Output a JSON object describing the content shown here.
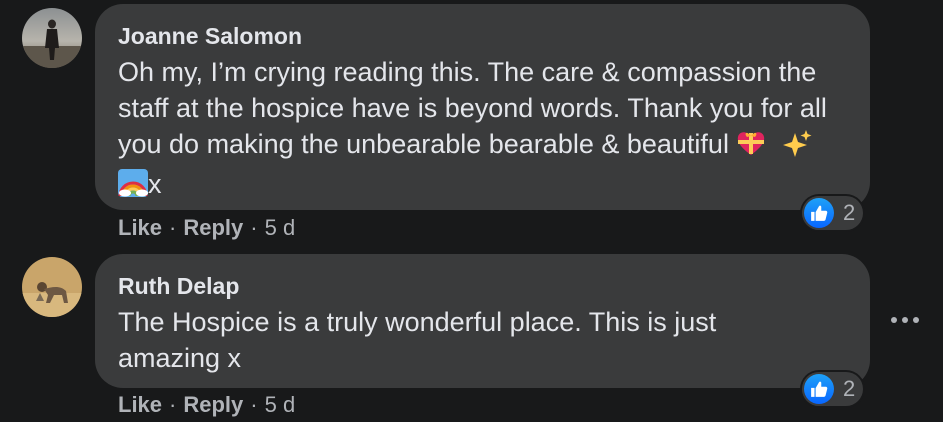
{
  "comments": [
    {
      "author": "Joanne Salomon",
      "text_main": "Oh my, I’m crying reading this. The care & compassion the staff at the hospice have is beyond words. Thank you for all you do making the unbearable bearable & beautiful",
      "text_suffix": "x",
      "emojis": [
        "heart-with-ribbon",
        "sparkles",
        "rainbow"
      ],
      "reaction_count": "2",
      "like_label": "Like",
      "reply_label": "Reply",
      "time": "5 d"
    },
    {
      "author": "Ruth Delap",
      "text_main": "The Hospice is a truly wonderful place. This is just amazing x",
      "reaction_count": "2",
      "like_label": "Like",
      "reply_label": "Reply",
      "time": "5 d"
    }
  ],
  "colors": {
    "background": "#18191a",
    "bubble": "#3a3b3c",
    "text": "#e4e6eb",
    "secondary": "#b0b3b8",
    "like_blue": "#1877f2"
  }
}
